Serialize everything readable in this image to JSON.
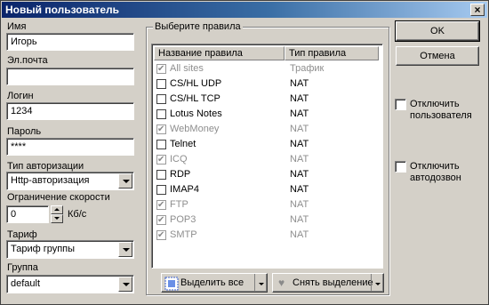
{
  "window": {
    "title": "Новый пользователь",
    "close_glyph": "×"
  },
  "form": {
    "name_label": "Имя",
    "name_value": "Игорь",
    "email_label": "Эл.почта",
    "email_value": "",
    "login_label": "Логин",
    "login_value": "1234",
    "password_label": "Пароль",
    "password_value": "****",
    "auth_label": "Тип авторизации",
    "auth_value": "Http-авторизация",
    "speed_label": "Ограничение скорости",
    "speed_value": "0",
    "speed_unit": "Кб/с",
    "tariff_label": "Тариф",
    "tariff_value": "Тариф группы",
    "group_label": "Группа",
    "group_value": "default"
  },
  "rules": {
    "group_title": "Выберите правила",
    "col_name": "Название правила",
    "col_type": "Тип правила",
    "items": [
      {
        "name": "All sites",
        "type": "Трафик",
        "checked": true,
        "disabled": true
      },
      {
        "name": "CS/HL UDP",
        "type": "NAT",
        "checked": false,
        "disabled": false
      },
      {
        "name": "CS/HL TCP",
        "type": "NAT",
        "checked": false,
        "disabled": false
      },
      {
        "name": "Lotus Notes",
        "type": "NAT",
        "checked": false,
        "disabled": false
      },
      {
        "name": "WebMoney",
        "type": "NAT",
        "checked": true,
        "disabled": true
      },
      {
        "name": "Telnet",
        "type": "NAT",
        "checked": false,
        "disabled": false
      },
      {
        "name": "ICQ",
        "type": "NAT",
        "checked": true,
        "disabled": true
      },
      {
        "name": "RDP",
        "type": "NAT",
        "checked": false,
        "disabled": false
      },
      {
        "name": "IMAP4",
        "type": "NAT",
        "checked": false,
        "disabled": false
      },
      {
        "name": "FTP",
        "type": "NAT",
        "checked": true,
        "disabled": true
      },
      {
        "name": "POP3",
        "type": "NAT",
        "checked": true,
        "disabled": true
      },
      {
        "name": "SMTP",
        "type": "NAT",
        "checked": true,
        "disabled": true
      }
    ],
    "select_all_label": "Выделить все",
    "deselect_label": "Снять выделение"
  },
  "actions": {
    "ok_label": "OK",
    "cancel_label": "Отмена"
  },
  "options": {
    "disable_user_line1": "Отключить",
    "disable_user_line2": "пользователя",
    "disable_autodial_line1": "Отключить",
    "disable_autodial_line2": "автодозвон"
  },
  "icons": {
    "select_all": "select-all-icon",
    "deselect": "heart-icon"
  }
}
